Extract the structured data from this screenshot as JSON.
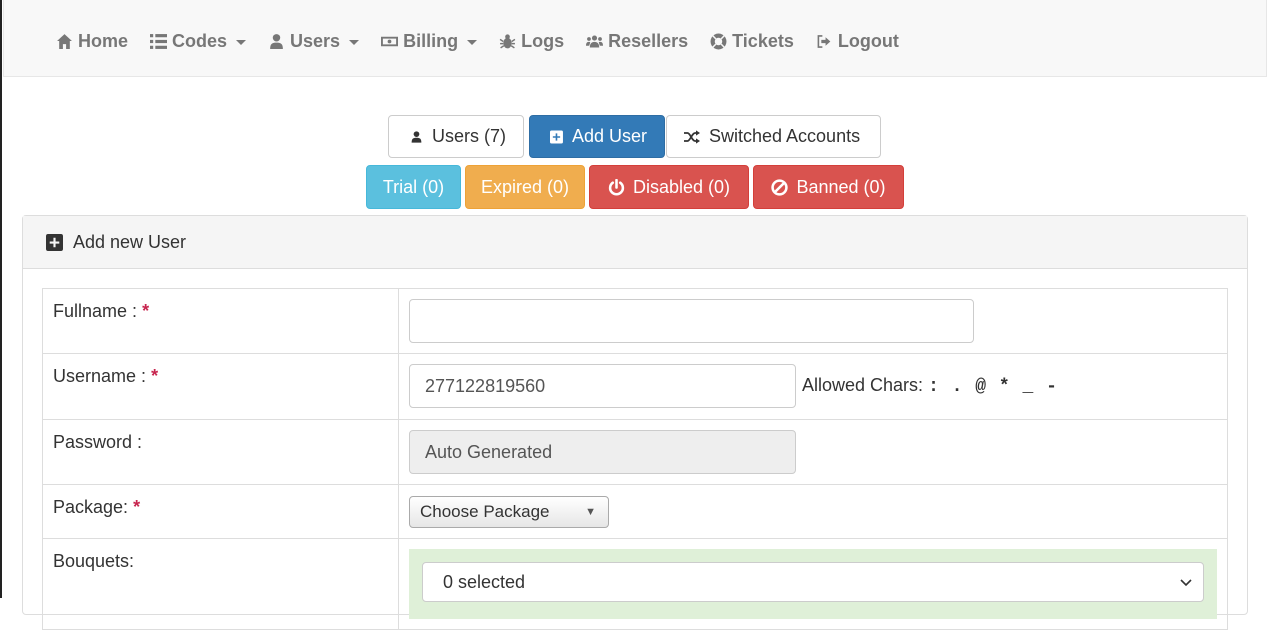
{
  "nav": {
    "home": "Home",
    "codes": "Codes",
    "users": "Users",
    "billing": "Billing",
    "logs": "Logs",
    "resellers": "Resellers",
    "tickets": "Tickets",
    "logout": "Logout"
  },
  "tabs": {
    "users": "Users (7)",
    "add_user": "Add User",
    "switched": "Switched Accounts"
  },
  "status": {
    "trial": "Trial (0)",
    "expired": "Expired (0)",
    "disabled": "Disabled (0)",
    "banned": "Banned (0)"
  },
  "panel": {
    "title": "Add new User"
  },
  "form": {
    "fullname_label": "Fullname :",
    "username_label": "Username :",
    "password_label": "Password :",
    "package_label": "Package:",
    "bouquets_label": "Bouquets:",
    "required_mark": "*",
    "fullname_value": "",
    "username_value": "277122819560",
    "allowed_prefix": "Allowed Chars:",
    "allowed_chars": ": . @ * _ -",
    "password_value": "Auto Generated",
    "package_selected": "Choose Package",
    "bouquets_selected": "0 selected"
  },
  "colors": {
    "primary": "#337ab7",
    "info": "#5bc0de",
    "warning": "#f0ad4e",
    "danger": "#d9534f",
    "success_bg": "#dff0d8"
  }
}
